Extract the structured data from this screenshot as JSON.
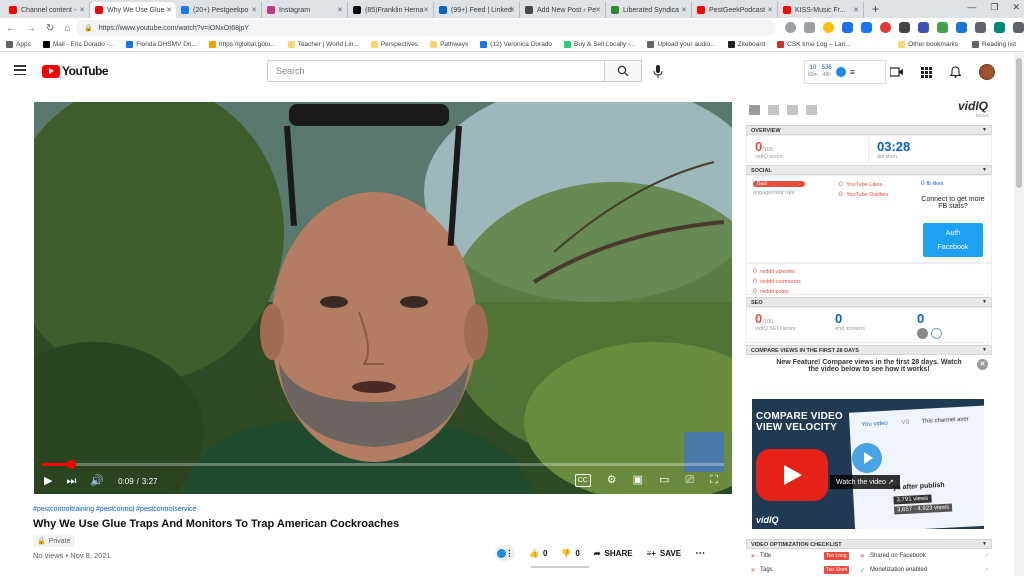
{
  "browser": {
    "tabs": [
      {
        "label": "Channel content -",
        "color": "#ff0000",
        "active": false
      },
      {
        "label": "Why We Use Glue",
        "color": "#ff0000",
        "active": true
      },
      {
        "label": "(20+) Pestgeekpo",
        "color": "#1877f2",
        "active": false
      },
      {
        "label": "Instagram",
        "color": "#c13584",
        "active": false
      },
      {
        "label": "(85)Franklin Herna",
        "color": "#000000",
        "active": false
      },
      {
        "label": "(99+) Feed | Linked",
        "color": "#0a66c2",
        "active": false
      },
      {
        "label": "Add New Post ‹ Pe",
        "color": "#464646",
        "active": false
      },
      {
        "label": "Liberated Syndica",
        "color": "#2d8a2d",
        "active": false
      },
      {
        "label": "PestGeekPodcast",
        "color": "#ff0000",
        "active": false
      },
      {
        "label": "KISS-Music Fr...",
        "color": "#ff0000",
        "active": false
      }
    ],
    "newtab": "+",
    "url": "https://www.youtube.com/watch?v=iONxOt68jpY",
    "bookmarks": [
      {
        "label": "Apps",
        "color": "#5f6368"
      },
      {
        "label": "Mail - Eric Dorado -...",
        "color": "#000000"
      },
      {
        "label": "Florida DHSMV Dri...",
        "color": "#1a73e8"
      },
      {
        "label": "https://global.goto...",
        "color": "#f4a300"
      },
      {
        "label": "Teacher | World Lin...",
        "color": "#f7d774"
      },
      {
        "label": "Perspectives",
        "color": "#f7d774"
      },
      {
        "label": "Pathways",
        "color": "#f7d774"
      },
      {
        "label": "(12) Veronica Dorado",
        "color": "#1877f2"
      },
      {
        "label": "Buy & Sell Locally -...",
        "color": "#2ecc71"
      },
      {
        "label": "Upload your audio...",
        "color": "#666666"
      },
      {
        "label": "Ziteboard",
        "color": "#222222"
      },
      {
        "label": "CSK time Log – Lan...",
        "color": "#c0392b"
      }
    ],
    "bookmarks_right": [
      "Other bookmarks",
      "Reading list"
    ]
  },
  "youtube": {
    "logo_text": "YouTube",
    "search_placeholder": "Search",
    "vidiq_stats": [
      {
        "value": "10",
        "label": "60m"
      },
      {
        "value": "536",
        "label": "48h"
      }
    ],
    "video": {
      "current_time": "0:09",
      "duration": "3:27",
      "time_separator": "/",
      "progress_fraction": 0.043,
      "hashtags": "#pestcontroltraining #pestcontrol #pestcontrolservice",
      "title": "Why We Use Glue Traps And Monitors To Trap American Cockroaches",
      "privacy": "Private",
      "views_date": "No views • Nov 8, 2021",
      "likes": "0",
      "dislikes": "0",
      "share": "SHARE",
      "save": "SAVE"
    }
  },
  "vidiq": {
    "logo": "vidIQ",
    "logo_sub": "boost",
    "overview_label": "OVERVIEW",
    "score": "0",
    "score_denom": "/100",
    "score_label": "vidIQ score",
    "duration": "03:28",
    "duration_label": "duration",
    "social_label": "SOCIAL",
    "engagement_badge": "Bad",
    "engagement_label": "engagement rate",
    "yt_likes_value": "0",
    "yt_likes_label": "YouTube Likes",
    "yt_dislikes_value": "0",
    "yt_dislikes_label": "YouTube Dislikes",
    "fb_likes_value": "0",
    "fb_likes_label": "fb likes",
    "fb_connect": "Connect to get more FB stats?",
    "auth_btn_line1": "Auth",
    "auth_btn_line2": "Facebook",
    "reddit": [
      {
        "value": "0",
        "label": "reddit upvotes"
      },
      {
        "value": "0",
        "label": "reddit comments"
      },
      {
        "value": "0",
        "label": "reddit posts"
      }
    ],
    "seo_label": "SEO",
    "seo_score": "0",
    "seo_denom": "/100",
    "seo_score_label": "vidIQ SEO score",
    "end_screens": "0",
    "end_screens_label": "end screens",
    "cards_value": "0",
    "compare_label": "COMPARE VIEWS IN THE FIRST 28 DAYS",
    "compare_text": "New Feature! Compare views in the first 28 days. Watch the video below to see how it works!",
    "promo_title_line1": "COMPARE VIDEO",
    "promo_title_line2": "VIEW VELOCITY",
    "promo_watch": "Watch the video",
    "promo_chart_texts": [
      "You video",
      "VS",
      "This channel aver",
      "ys after publish",
      "3,791 views",
      "3,657 - 4,923 views"
    ],
    "checklist_label": "VIDEO OPTIMIZATION CHECKLIST",
    "checklist": [
      {
        "label": "Title",
        "badge": "Too Long",
        "right": "Shared on Facebook"
      },
      {
        "label": "Tags",
        "badge": "Too Short",
        "right": "Monetization enabled"
      }
    ]
  }
}
